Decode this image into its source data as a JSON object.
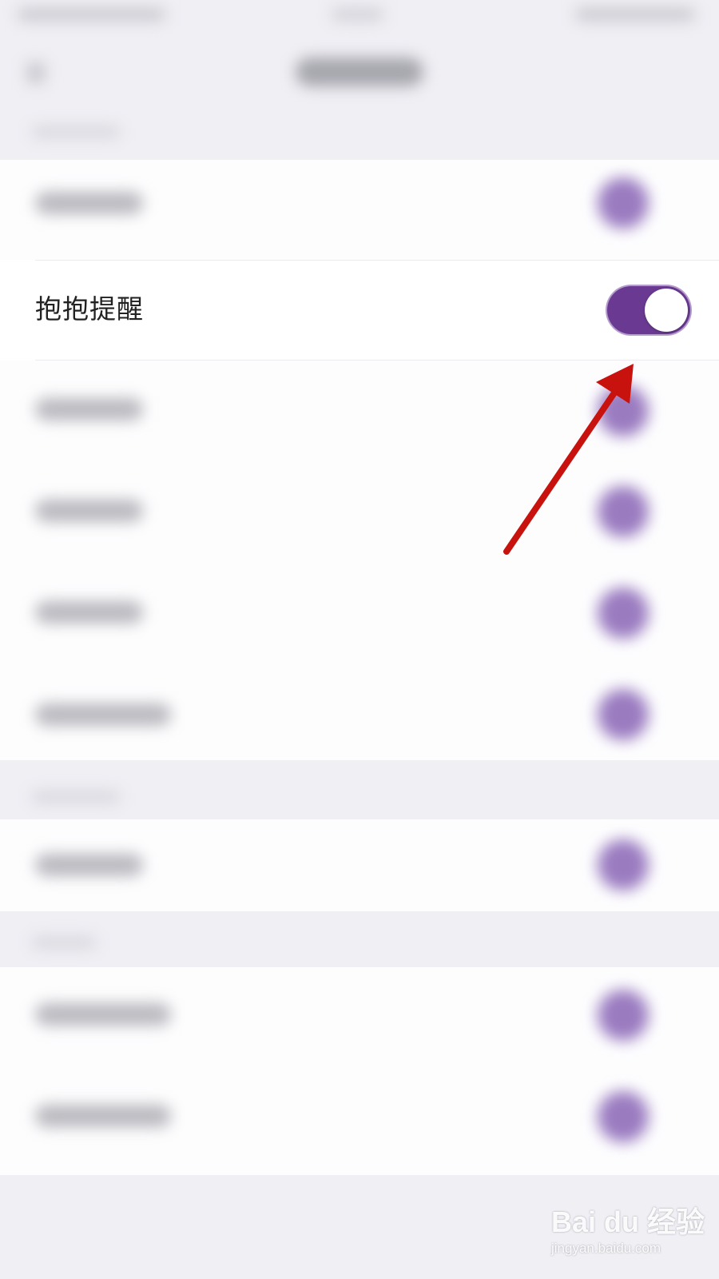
{
  "settings": {
    "hug_reminder": {
      "label": "抱抱提醒",
      "enabled": true
    }
  },
  "colors": {
    "toggle_on": "#6a3a92",
    "annotation_arrow": "#c8120d"
  },
  "watermark": {
    "brand": "Bai du 经验",
    "url": "jingyan.baidu.com"
  }
}
